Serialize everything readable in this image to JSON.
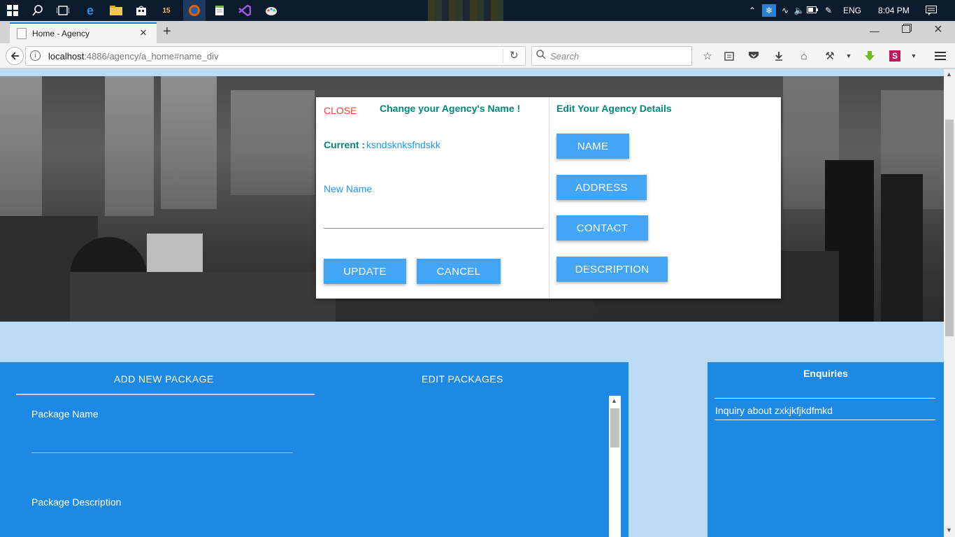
{
  "taskbar": {
    "icons": [
      "windows-start-icon",
      "search-icon",
      "task-view-icon",
      "edge-icon",
      "file-explorer-icon",
      "store-icon",
      "app-15-icon",
      "firefox-icon",
      "notepad-icon",
      "visual-studio-icon",
      "paint-icon"
    ],
    "tray": {
      "lang": "ENG",
      "time": "8:04 PM"
    }
  },
  "browser": {
    "tab_title": "Home - Agency",
    "url_host": "localhost",
    "url_rest": ":4886/agency/a_home#name_div",
    "search_placeholder": "Search"
  },
  "modal": {
    "close_label": "CLOSE",
    "left_title": "Change your Agency's Name !",
    "current_label": "Current :",
    "current_value": "ksndsknksfndskk",
    "new_name_label": "New Name",
    "new_name_value": "",
    "update_label": "UPDATE",
    "cancel_label": "CANCEL",
    "right_title": "Edit Your Agency Details",
    "options": [
      "NAME",
      "ADDRESS",
      "CONTACT",
      "DESCRIPTION"
    ]
  },
  "packages": {
    "tab_add": "ADD NEW PACKAGE",
    "tab_edit": "EDIT PACKAGES",
    "package_name_label": "Package Name",
    "package_description_label": "Package Description"
  },
  "enquiries": {
    "title": "Enquiries",
    "items": [
      "Inquiry about zxkjkfjkdfmkd"
    ]
  },
  "colors": {
    "accent": "#42a5f5",
    "panel": "#1e88e5",
    "teal_text": "#00897b",
    "close_red": "#f44336",
    "page_bg": "#bcdcf5"
  }
}
